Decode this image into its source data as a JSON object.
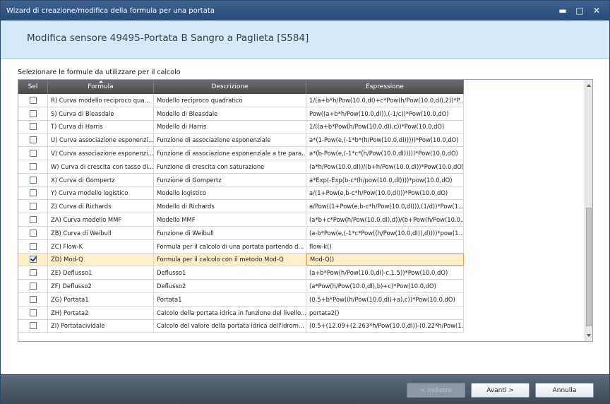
{
  "window": {
    "title": "Wizard di creazione/modifica della formula per una portata",
    "minimize_glyph": "▬",
    "maximize_glyph": "□",
    "close_glyph": "✕"
  },
  "header": {
    "title": "Modifica sensore 49495-Portata B Sangro a Paglieta [S584]"
  },
  "section_label": "Selezionare le formule da utilizzare per il calcolo",
  "table": {
    "columns": {
      "sel": "Sel",
      "formula": "Formula",
      "descrizione": "Descrizione",
      "espressione": "Espressione"
    },
    "sorted_column": "formula",
    "rows": [
      {
        "checked": false,
        "formula": "R) Curva modello reciproco qua...",
        "descrizione": "Modello reciproco quadratico",
        "espressione": "1/(a+b*h/Pow(10.0,dI)+c*Pow(h/Pow(10.0,dI),2))*P..."
      },
      {
        "checked": false,
        "formula": "S) Curva di Bleasdale",
        "descrizione": "Modello di Bleasdale",
        "espressione": "Pow((a+b*h/Pow(10.0,dI)),(-1/c))*Pow(10.0,dO)"
      },
      {
        "checked": false,
        "formula": "T) Curva di Harris",
        "descrizione": "Modello di Harris",
        "espressione": "1/((a+b*Pow(h/Pow(10.0,dI),c))*Pow(10.0,dO)"
      },
      {
        "checked": false,
        "formula": "U) Curva associazione esponenzi...",
        "descrizione": "Funzione di associazione esponenziale",
        "espressione": "a*(1-Pow(e,(-1*b*(h/Pow(10.0,dI)))))*Pow(10.0,dO)"
      },
      {
        "checked": false,
        "formula": "V) Curva associazione esponenzi...",
        "descrizione": "Funzione di associazione esponenziale a tre para...",
        "espressione": "a*(b-Pow(e,(-1*c*(h/Pow(10.0,dI)))))*Pow(10.0,dO)"
      },
      {
        "checked": false,
        "formula": "W) Curva di crescita con tasso di...",
        "descrizione": "Funzione di crescita con saturazione",
        "espressione": "(a*h/Pow(10.0,dI))/(b+h/Pow(10.0,dI))*Pow(10.0,dO)"
      },
      {
        "checked": false,
        "formula": "X) Curva di Gompertz",
        "descrizione": "Funzione di Gompertz",
        "espressione": "a*Exp(-Exp(b-c*(h/pow(10.0,dI))))*pow(10.0,dO)"
      },
      {
        "checked": false,
        "formula": "Y) Curva modello logistico",
        "descrizione": "Modello logistico",
        "espressione": "a/(1+Pow(e,b-c*h/Pow(10.0,dI)))*Pow(10.0,dO)"
      },
      {
        "checked": false,
        "formula": "Z) Curva di Richards",
        "descrizione": "Modello di Richards",
        "espressione": "a/Pow((1+Pow(e,b-c*h/Pow(10.0,dI))),(1/d))*Pow(1..."
      },
      {
        "checked": false,
        "formula": "ZA) Curva modello MMF",
        "descrizione": "Modello MMF",
        "espressione": "(a*b+c*Pow(h/Pow(10.0,dI),d))/(b+Pow(h/Pow(10.0..."
      },
      {
        "checked": false,
        "formula": "ZB) Curva di Weibull",
        "descrizione": "Funzione di Weibull",
        "espressione": "(a-b*Pow(e,(-1*c*Pow((h/Pow(10.0,dI)),d))))*pow(1..."
      },
      {
        "checked": false,
        "formula": "ZC) Flow-K",
        "descrizione": "Formula per il calcolo di una portata partendo d...",
        "espressione": "flow-k()"
      },
      {
        "checked": true,
        "selected": true,
        "formula": "ZD) Mod-Q",
        "descrizione": "Formula per il calcolo con il metodo Mod-Q",
        "espressione": "Mod-Q()"
      },
      {
        "checked": false,
        "formula": "ZE) Deflusso1",
        "descrizione": "Deflusso1",
        "espressione": "(a+b*Pow(h/Pow(10.0,dI)-c,1.5))*Pow(10.0,dO)"
      },
      {
        "checked": false,
        "formula": "ZF) Deflusso2",
        "descrizione": "Deflusso2",
        "espressione": "(a*Pow(h/Pow(10.0,dI),b)+c)*Pow(10.0,dO)"
      },
      {
        "checked": false,
        "formula": "ZG) Portata1",
        "descrizione": "Portata1",
        "espressione": "(0.5+b*Pow((h/Pow(10.0,dI)+a),c))*Pow(10.0,dO)"
      },
      {
        "checked": false,
        "formula": "ZH) Portata2",
        "descrizione": "Calcolo della portata idrica in funzione del livello...",
        "espressione": "portata2()"
      },
      {
        "checked": false,
        "formula": "ZI) Portatacividale",
        "descrizione": "Calcolo del valore della portata idrica dell'idrom...",
        "espressione": "(0.5+(12.09+(2.263*h/Pow(10.0,dI))-(0.22*h/Pow(1..."
      }
    ]
  },
  "footer": {
    "back_label": "< Indietro",
    "next_label": "Avanti >",
    "cancel_label": "Annulla"
  },
  "colors": {
    "titlebar": "#234a78",
    "header_bg": "#d6e9f8",
    "grid_header": "#4a4a4a",
    "selected_row": "#fdf0c8",
    "selected_border": "#f0a040",
    "footer": "#3e4a57"
  }
}
